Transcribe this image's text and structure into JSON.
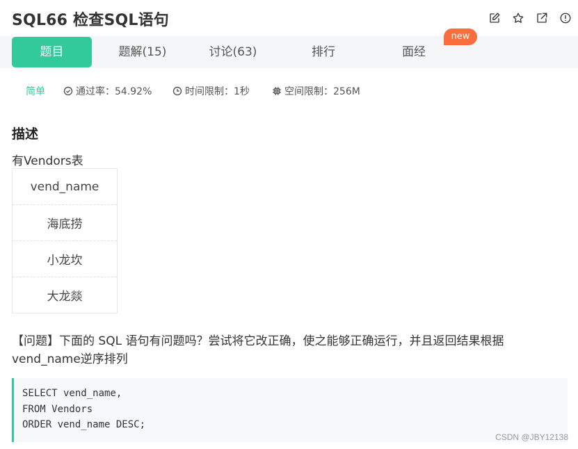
{
  "header": {
    "title": "SQL66  检查SQL语句",
    "icons": [
      "edit-icon",
      "star-icon",
      "external-link-icon",
      "info-icon"
    ]
  },
  "tabs": [
    {
      "label": "题目",
      "active": true
    },
    {
      "label": "题解(15)",
      "active": false
    },
    {
      "label": "讨论(63)",
      "active": false
    },
    {
      "label": "排行",
      "active": false
    },
    {
      "label": "面经",
      "active": false
    }
  ],
  "new_badge": "new",
  "meta": {
    "difficulty": "简单",
    "pass_rate": "通过率：54.92%",
    "time_limit": "时间限制：1秒",
    "space_limit": "空间限制：256M"
  },
  "description": {
    "heading": "描述",
    "table_caption": "有Vendors表",
    "table": {
      "header": "vend_name",
      "rows": [
        "海底捞",
        "小龙坎",
        "大龙燚"
      ]
    },
    "question": "【问题】下面的 SQL 语句有问题吗？尝试将它改正确，使之能够正确运行，并且返回结果根据vend_name逆序排列"
  },
  "code": {
    "lines": [
      "SELECT vend_name,",
      "FROM Vendors",
      "ORDER vend_name DESC;"
    ]
  },
  "watermark": "CSDN @JBY12138",
  "colors": {
    "accent": "#32ca99",
    "badge": "#fa6d3d",
    "tab_bar_bg": "#f5f6f7",
    "code_bg": "#f7f8f9"
  }
}
